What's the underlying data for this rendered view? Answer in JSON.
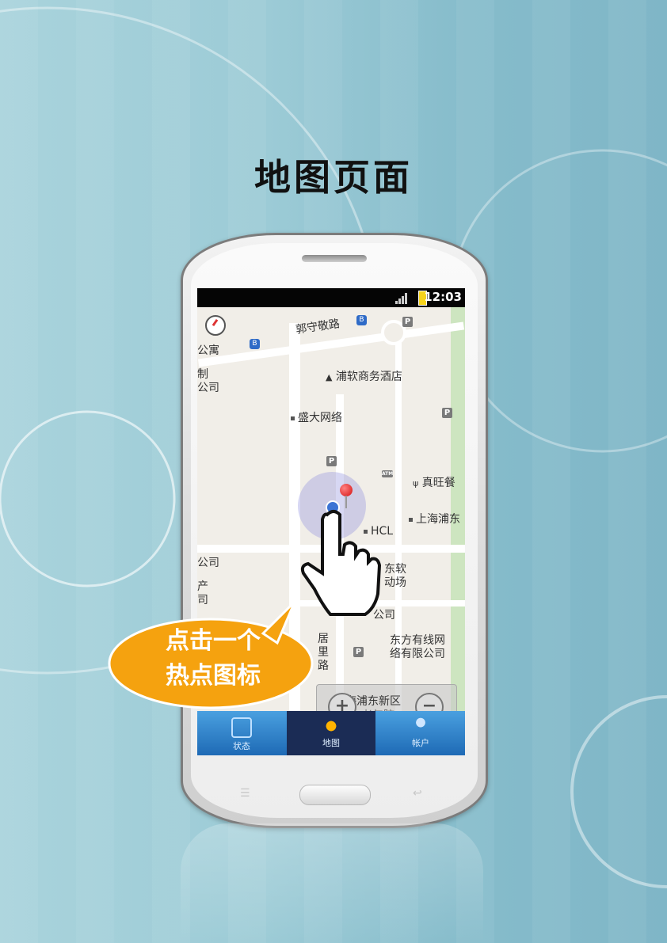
{
  "page_title": "地图页面",
  "status_bar": {
    "time": "12:03"
  },
  "map": {
    "labels": {
      "guoshoujing": "郭守敬路",
      "gongyu": "公寓",
      "zhi": "制",
      "gongsi_1": "公司",
      "hotel": "浦软商务酒店",
      "shengda": "盛大网络",
      "zhenwang": "真旺餐",
      "pudong_sh": "上海浦东",
      "hcl": "HCL",
      "gongsi_2": "公司",
      "chan": "产",
      "si": "司",
      "pusoft": "东软",
      "yundong": "动场",
      "gongsi_3": "公司",
      "ju": "居",
      "li": "里",
      "lu": "路",
      "dongfang_1": "东方有线网",
      "dongfang_2": "络有限公司",
      "pudong_new": "上海浦东新区",
      "elder": "浦东老年院"
    }
  },
  "zoom": {
    "in_label": "+",
    "out_label": "−"
  },
  "tabs": [
    {
      "label": "状态"
    },
    {
      "label": "地图"
    },
    {
      "label": "帐户"
    }
  ],
  "callout": {
    "line1": "点击一个",
    "line2": "热点图标"
  },
  "colors": {
    "bubble": "#f5a20f",
    "tab_active": "#1b2c55",
    "pin": "#d41010"
  }
}
